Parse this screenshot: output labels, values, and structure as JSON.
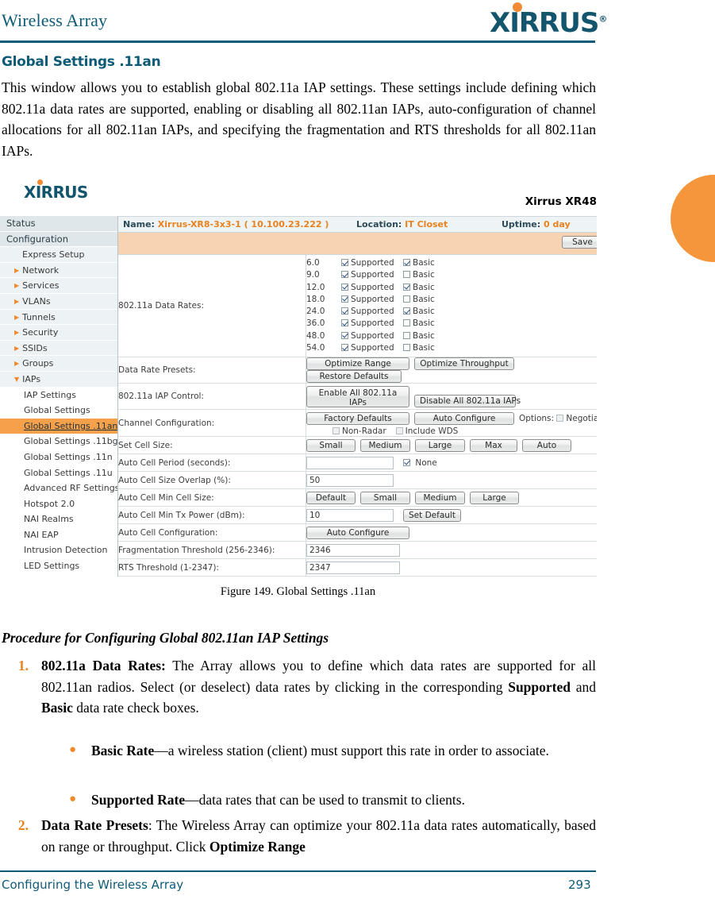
{
  "page_header": {
    "doc_title": "Wireless Array",
    "logo_text": "XIRRUS",
    "logo_tm": "®"
  },
  "section": {
    "title": "Global Settings .11an",
    "intro": "This window allows you to establish global 802.11a IAP settings. These settings include defining which 802.11a data rates are supported, enabling or disabling all 802.11an IAPs, auto-configuration of channel allocations for all 802.11an IAPs, and specifying the fragmentation and RTS thresholds for all 802.11an IAPs."
  },
  "screenshot": {
    "logo_text": "XIRRUS",
    "product_label": "Xirrus XR48",
    "sidebar": [
      {
        "label": "Status",
        "level": "top",
        "arrow": false
      },
      {
        "label": "Configuration",
        "level": "top",
        "arrow": false
      },
      {
        "label": "Express Setup",
        "level": "l1",
        "arrow": false
      },
      {
        "label": "Network",
        "level": "l1",
        "arrow": true
      },
      {
        "label": "Services",
        "level": "l1",
        "arrow": true
      },
      {
        "label": "VLANs",
        "level": "l1",
        "arrow": true
      },
      {
        "label": "Tunnels",
        "level": "l1",
        "arrow": true
      },
      {
        "label": "Security",
        "level": "l1",
        "arrow": true
      },
      {
        "label": "SSIDs",
        "level": "l1",
        "arrow": true
      },
      {
        "label": "Groups",
        "level": "l1",
        "arrow": true
      },
      {
        "label": "IAPs",
        "level": "l1",
        "arrow": "down"
      },
      {
        "label": "IAP Settings",
        "level": "l2",
        "arrow": false
      },
      {
        "label": "Global Settings",
        "level": "l2",
        "arrow": false
      },
      {
        "label": "Global Settings .11an",
        "level": "l2",
        "arrow": false,
        "selected": true
      },
      {
        "label": "Global Settings .11bgn",
        "level": "l2",
        "arrow": false
      },
      {
        "label": "Global Settings .11n",
        "level": "l2",
        "arrow": false
      },
      {
        "label": "Global Settings .11u",
        "level": "l2",
        "arrow": false
      },
      {
        "label": "Advanced RF Settings",
        "level": "l2",
        "arrow": false
      },
      {
        "label": "Hotspot 2.0",
        "level": "l2",
        "arrow": false
      },
      {
        "label": "NAI Realms",
        "level": "l2",
        "arrow": false
      },
      {
        "label": "NAI EAP",
        "level": "l2",
        "arrow": false
      },
      {
        "label": "Intrusion Detection",
        "level": "l2",
        "arrow": false
      },
      {
        "label": "LED Settings",
        "level": "l2",
        "arrow": false
      }
    ],
    "infobar": {
      "name_label": "Name:",
      "name_value": "Xirrus-XR8-3x3-1   ( 10.100.23.222 )",
      "location_label": "Location:",
      "location_value": "IT Closet",
      "uptime_label": "Uptime:",
      "uptime_value": "0 day"
    },
    "save_button": "Save",
    "rows": {
      "data_rates_label": "802.11a Data Rates:",
      "data_rates": [
        {
          "rate": "6.0",
          "supported_label": "Supported",
          "supported": true,
          "basic_label": "Basic",
          "basic": true
        },
        {
          "rate": "9.0",
          "supported_label": "Supported",
          "supported": true,
          "basic_label": "Basic",
          "basic": false
        },
        {
          "rate": "12.0",
          "supported_label": "Supported",
          "supported": true,
          "basic_label": "Basic",
          "basic": true
        },
        {
          "rate": "18.0",
          "supported_label": "Supported",
          "supported": true,
          "basic_label": "Basic",
          "basic": false
        },
        {
          "rate": "24.0",
          "supported_label": "Supported",
          "supported": true,
          "basic_label": "Basic",
          "basic": true
        },
        {
          "rate": "36.0",
          "supported_label": "Supported",
          "supported": true,
          "basic_label": "Basic",
          "basic": false
        },
        {
          "rate": "48.0",
          "supported_label": "Supported",
          "supported": true,
          "basic_label": "Basic",
          "basic": false
        },
        {
          "rate": "54.0",
          "supported_label": "Supported",
          "supported": true,
          "basic_label": "Basic",
          "basic": false
        }
      ],
      "presets_label": "Data Rate Presets:",
      "presets_buttons": [
        "Optimize Range",
        "Optimize Throughput",
        "Restore Defaults"
      ],
      "iap_control_label": "802.11a IAP Control:",
      "iap_enable_button": "Enable All 802.11a IAPs",
      "iap_disable_button": "Disable All 802.11a IAPs",
      "channel_cfg_label": "Channel Configuration:",
      "channel_factory_button": "Factory Defaults",
      "channel_auto_button": "Auto Configure",
      "channel_options_label": "Options:",
      "channel_negotiate_label": "Negotiat",
      "channel_negotiate_checked": false,
      "channel_nonradar_label": "Non-Radar",
      "channel_nonradar_checked": false,
      "channel_wds_label": "Include WDS",
      "channel_wds_checked": false,
      "cell_size_label": "Set Cell Size:",
      "cell_size_buttons": [
        "Small",
        "Medium",
        "Large",
        "Max",
        "Auto"
      ],
      "auto_cell_period_label": "Auto Cell Period (seconds):",
      "auto_cell_period_value": "",
      "auto_cell_period_none_label": "None",
      "auto_cell_period_none_checked": true,
      "auto_cell_overlap_label": "Auto Cell Size Overlap (%):",
      "auto_cell_overlap_value": "50",
      "auto_cell_min_size_label": "Auto Cell Min Cell Size:",
      "auto_cell_min_size_buttons": [
        "Default",
        "Small",
        "Medium",
        "Large"
      ],
      "auto_cell_min_tx_label": "Auto Cell Min Tx Power (dBm):",
      "auto_cell_min_tx_value": "10",
      "auto_cell_min_tx_button": "Set Default",
      "auto_cell_cfg_label": "Auto Cell Configuration:",
      "auto_cell_cfg_button": "Auto Configure",
      "frag_label": "Fragmentation Threshold (256-2346):",
      "frag_value": "2346",
      "rts_label": "RTS Threshold (1-2347):",
      "rts_value": "2347"
    }
  },
  "figure_caption": "Figure 149. Global Settings .11an",
  "procedure": {
    "title": "Procedure for Configuring Global 802.11an IAP Settings",
    "step1": {
      "num": "1.",
      "bold_lead": "802.11a Data Rates:",
      "text_a": " The Array allows you to define which data rates are supported for all 802.11an radios. Select (or deselect) data rates by clicking in the corresponding ",
      "bold_b": "Supported",
      "text_b": " and ",
      "bold_c": "Basic",
      "text_c": " data rate check boxes."
    },
    "bullet1": {
      "bold_lead": "Basic Rate",
      "text": "—a wireless station (client) must support this rate in order to associate."
    },
    "bullet2": {
      "bold_lead": "Supported Rate",
      "text": "—data rates that can be used to transmit to clients."
    },
    "step2": {
      "num": "2.",
      "bold_lead": "Data Rate Presets",
      "text_a": ": The Wireless Array can optimize your 802.11a data rates automatically, based on range or throughput. Click ",
      "bold_b": "Optimize Range"
    }
  },
  "footer": {
    "left": "Configuring the Wireless Array",
    "right": "293"
  },
  "colors": {
    "brand_teal": "#0d5b76",
    "brand_orange": "#f08a2e",
    "selected_row": "#f5a14b",
    "savebar": "#f7d3b2"
  }
}
